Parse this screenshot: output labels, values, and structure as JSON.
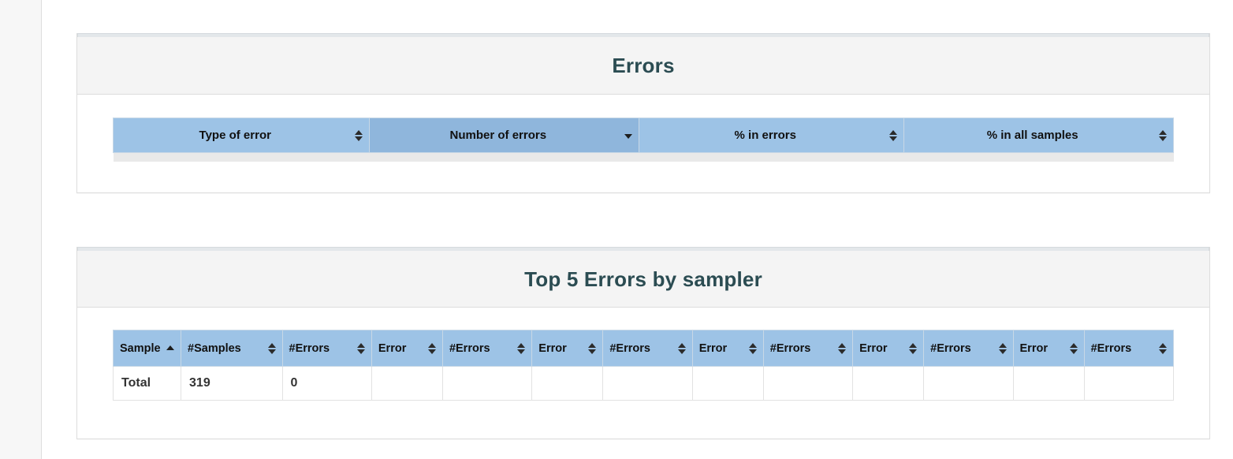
{
  "panels": [
    {
      "id": "errors",
      "title": "Errors",
      "table": {
        "columns": [
          {
            "label": "Type of error",
            "sort": "none",
            "sort_icon": "sort-both-icon"
          },
          {
            "label": "Number of errors",
            "sort": "desc",
            "sort_icon": "sort-descending-icon"
          },
          {
            "label": "% in errors",
            "sort": "none",
            "sort_icon": "sort-both-icon"
          },
          {
            "label": "% in all samples",
            "sort": "none",
            "sort_icon": "sort-both-icon"
          }
        ],
        "rows": []
      }
    },
    {
      "id": "top5",
      "title": "Top 5 Errors by sampler",
      "table": {
        "columns": [
          {
            "label": "Sample",
            "sort": "asc",
            "sort_icon": "sort-ascending-icon"
          },
          {
            "label": "#Samples",
            "sort": "none",
            "sort_icon": "sort-both-icon"
          },
          {
            "label": "#Errors",
            "sort": "none",
            "sort_icon": "sort-both-icon"
          },
          {
            "label": "Error",
            "sort": "none",
            "sort_icon": "sort-both-icon"
          },
          {
            "label": "#Errors",
            "sort": "none",
            "sort_icon": "sort-both-icon"
          },
          {
            "label": "Error",
            "sort": "none",
            "sort_icon": "sort-both-icon"
          },
          {
            "label": "#Errors",
            "sort": "none",
            "sort_icon": "sort-both-icon"
          },
          {
            "label": "Error",
            "sort": "none",
            "sort_icon": "sort-both-icon"
          },
          {
            "label": "#Errors",
            "sort": "none",
            "sort_icon": "sort-both-icon"
          },
          {
            "label": "Error",
            "sort": "none",
            "sort_icon": "sort-both-icon"
          },
          {
            "label": "#Errors",
            "sort": "none",
            "sort_icon": "sort-both-icon"
          },
          {
            "label": "Error",
            "sort": "none",
            "sort_icon": "sort-both-icon"
          },
          {
            "label": "#Errors",
            "sort": "none",
            "sort_icon": "sort-both-icon"
          }
        ],
        "rows": [
          [
            "Total",
            "319",
            "0",
            "",
            "",
            "",
            "",
            "",
            "",
            "",
            "",
            "",
            ""
          ]
        ]
      }
    }
  ],
  "colors": {
    "panel_title": "#2b4c52",
    "header_blue": "#9dc3e6",
    "header_blue_sorted": "#8fb6dc",
    "panel_heading_bg": "#f4f4f4",
    "panel_border": "#dddddd",
    "sidebar_bg": "#f7f7f7"
  }
}
